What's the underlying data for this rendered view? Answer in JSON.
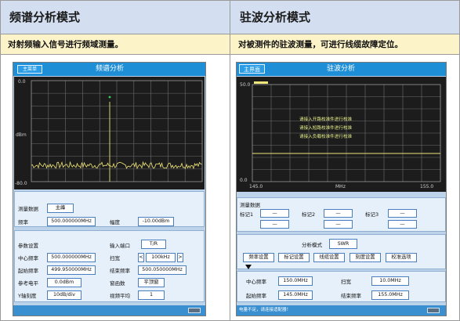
{
  "headers": {
    "left": "频谱分析模式",
    "right": "驻波分析模式"
  },
  "descriptions": {
    "left": "对射频输入信号进行频域测量。",
    "right": "对被测件的驻波测量，可进行线缆故障定位。"
  },
  "spectrum": {
    "menu_button": "主菜单",
    "title": "频谱分析",
    "y_top": "0.0",
    "y_unit": "dBm",
    "y_bottom": "-80.0",
    "measure_label": "测量数据",
    "marker_button": "主峰",
    "freq_label": "频率",
    "freq_value": "500.000000MHz",
    "amp_label": "幅度",
    "amp_value": "-10.00dBm",
    "params_label": "参数设置",
    "input_port_label": "输入端口",
    "input_port_value": "T/R",
    "center_label": "中心频率",
    "center_value": "500.000000MHz",
    "span_label": "扫宽",
    "span_value": "100kHz",
    "span_prev": "<",
    "span_next": ">",
    "start_label": "起始频率",
    "start_value": "499.950000MHz",
    "stop_label": "结束频率",
    "stop_value": "500.050000MHz",
    "ref_label": "参考电平",
    "ref_value": "0.0dBm",
    "window_label": "窗函数",
    "window_value": "平顶窗",
    "ydiv_label": "Y轴刻度",
    "ydiv_value": "10dB/div",
    "avg_label": "视频平均",
    "avg_value": "1"
  },
  "vswr": {
    "main_button": "主界面",
    "title": "驻波分析",
    "y_top": "50.0",
    "y_bottom": "0.0",
    "x_start": "145.0",
    "x_unit": "MHz",
    "x_end": "155.0",
    "ann1": "请接入开路校准件进行校准",
    "ann2": "请接入短路校准件进行校准",
    "ann3": "请接入负载校准件进行校准",
    "measure_label": "测量数据",
    "marker1": "标记1",
    "marker2": "标记2",
    "marker3": "标记3",
    "marker_dash": "—",
    "mode_label": "分析模式",
    "mode_value": "SWR",
    "tabs": [
      "频率设置",
      "标记设置",
      "线缆设置",
      "刻度设置",
      "校准选项"
    ],
    "center_label": "中心频率",
    "center_value": "150.0MHz",
    "span_label": "扫宽",
    "span_value": "10.0MHz",
    "start_label": "起始频率",
    "start_value": "145.0MHz",
    "stop_label": "结束频率",
    "stop_value": "155.0MHz",
    "status": "电量不足，请连接适配器！"
  },
  "chart_data": [
    {
      "type": "line",
      "title": "频谱分析",
      "ylabel": "dBm",
      "ylim": [
        -80.0,
        0.0
      ],
      "peak": {
        "x": "500.000000MHz",
        "y": -10.0
      },
      "noise_floor": -67,
      "grid": true
    },
    {
      "type": "line",
      "title": "驻波分析",
      "xlabel": "MHz",
      "xlim": [
        145.0,
        155.0
      ],
      "ylim": [
        0.0,
        50.0
      ],
      "grid": true
    }
  ]
}
